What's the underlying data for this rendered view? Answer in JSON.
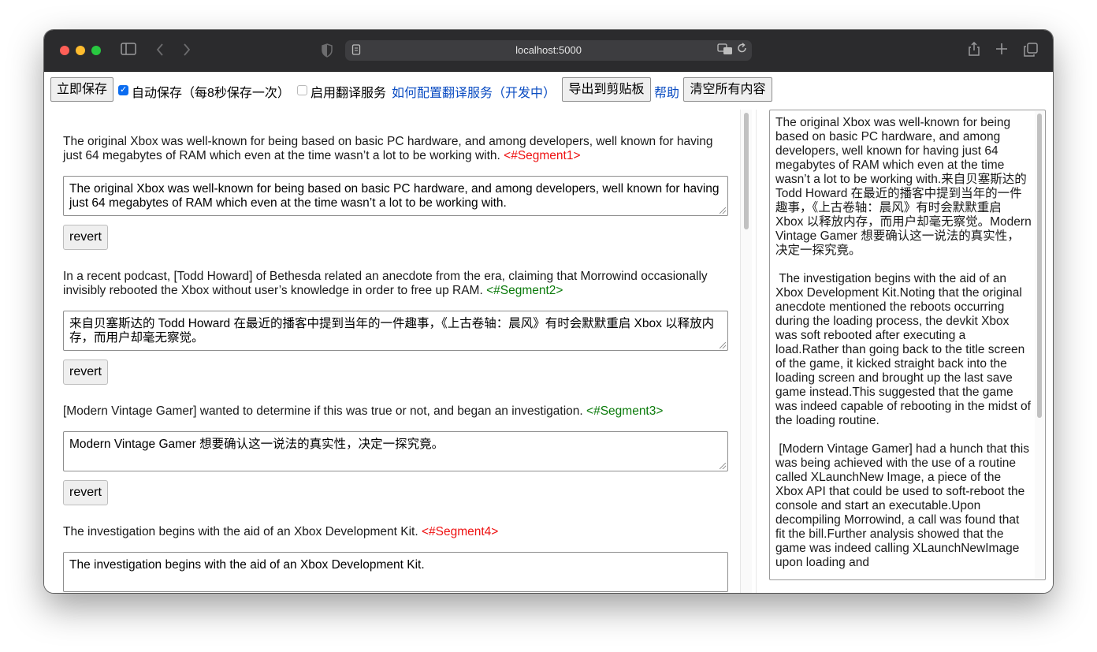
{
  "browser": {
    "url": "localhost:5000"
  },
  "toolbar": {
    "save_now": "立即保存",
    "autosave_label": "自动保存（每8秒保存一次）",
    "autosave_checked": true,
    "translate_label": "启用翻译服务",
    "translate_checked": false,
    "how_to_config_link": "如何配置翻译服务（开发中）",
    "export_clipboard": "导出到剪贴板",
    "help_link": "帮助",
    "clear_all": "清空所有内容"
  },
  "segments": [
    {
      "source": "The original Xbox was well-known for being based on basic PC hardware, and among developers, well known for having just 64 megabytes of RAM which even at the time wasn’t a lot to be working with.",
      "tag": "<#Segment1>",
      "tag_color": "#ee1111",
      "translation": "The original Xbox was well-known for being based on basic PC hardware, and among developers, well known for having just 64 megabytes of RAM which even at the time wasn’t a lot to be working with.",
      "revert_label": "revert"
    },
    {
      "source": "In a recent podcast, [Todd Howard] of Bethesda related an anecdote from the era, claiming that Morrowind occasionally invisibly rebooted the Xbox without user’s knowledge in order to free up RAM.",
      "tag": "<#Segment2>",
      "tag_color": "#0a7a0a",
      "translation": "来自贝塞斯达的 Todd Howard 在最近的播客中提到当年的一件趣事，《上古卷轴：晨风》有时会默默重启 Xbox 以释放内存，而用户却毫无察觉。",
      "revert_label": "revert"
    },
    {
      "source": "[Modern Vintage Gamer] wanted to determine if this was true or not, and began an investigation.",
      "tag": "<#Segment3>",
      "tag_color": "#0a7a0a",
      "translation": "Modern Vintage Gamer 想要确认这一说法的真实性，决定一探究竟。",
      "revert_label": "revert"
    },
    {
      "source": "The investigation begins with the aid of an Xbox Development Kit.",
      "tag": "<#Segment4>",
      "tag_color": "#ee1111",
      "translation": "The investigation begins with the aid of an Xbox Development Kit."
    }
  ],
  "output": {
    "text": "The original Xbox was well-known for being based on basic PC hardware, and among developers, well known for having just 64 megabytes of RAM which even at the time wasn’t a lot to be working with.来自贝塞斯达的 Todd Howard 在最近的播客中提到当年的一件趣事，《上古卷轴：晨风》有时会默默重启 Xbox 以释放内存，而用户却毫无察觉。Modern Vintage Gamer 想要确认这一说法的真实性，决定一探究竟。\n\n The investigation begins with the aid of an Xbox Development Kit.Noting that the original anecdote mentioned the reboots occurring during the loading process, the devkit Xbox was soft rebooted after executing a load.Rather than going back to the title screen of the game, it kicked straight back into the loading screen and brought up the last save game instead.This suggested that the game was indeed capable of rebooting in the midst of the loading routine.\n\n [Modern Vintage Gamer] had a hunch that this was being achieved with the use of a routine called XLaunchNew Image, a piece of the Xbox API that could be used to soft-reboot the console and start an executable.Upon decompiling Morrowind, a call was found that fit the bill.Further analysis showed that the game was indeed calling XLaunchNewImage upon loading and"
  }
}
